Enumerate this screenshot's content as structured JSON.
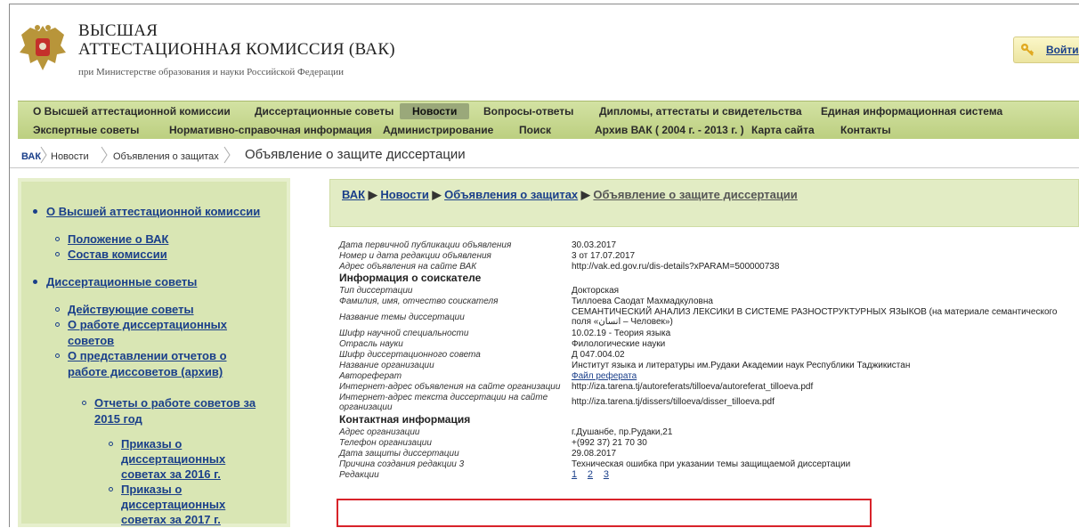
{
  "header": {
    "org_line1": "ВЫСШАЯ",
    "org_line2": "АТТЕСТАЦИОННАЯ КОМИССИЯ (ВАК)",
    "org_sub": "при Министерстве образования и науки Российской Федерации",
    "login_label": "Войти"
  },
  "menu": {
    "row1": [
      "О Высшей аттестационной комиссии",
      "Диссертационные советы",
      "Новости",
      "Вопросы-ответы",
      "Дипломы, аттестаты и свидетельства",
      "Единая информационная система"
    ],
    "row2": [
      "Экспертные советы",
      "Нормативно-справочная информация",
      "Администрирование",
      "Поиск",
      "Архив ВАК ( 2004 г. - 2013 г. )",
      "Карта сайта",
      "Контакты"
    ],
    "active": "Новости"
  },
  "breadcrumb": {
    "items": [
      "ВАК",
      "Новости",
      "Объявления о защитах"
    ],
    "title": "Объявление о защите диссертации"
  },
  "sidebar": {
    "items": [
      "О Высшей аттестационной комиссии",
      "Положение о ВАК",
      "Состав комиссии",
      "Диссертационные советы",
      "Действующие советы",
      "О работе диссертационных",
      "советов",
      "О представлении отчетов о",
      "работе диссоветов (архив)",
      "Отчеты о работе советов за",
      "2015 год",
      "Приказы о",
      "диссертационных",
      "советах за 2016 г.",
      "Приказы о",
      "диссертационных",
      "советах за 2017 г."
    ]
  },
  "content": {
    "path": {
      "root": "ВАК",
      "news": "Новости",
      "announcements": "Объявления о защитах",
      "current": "Объявление о защите диссертации",
      "sep": "▶"
    },
    "rows": [
      {
        "label": "Дата первичной публикации объявления",
        "value": "30.03.2017"
      },
      {
        "label": "Номер и дата редакции объявления",
        "value": "3 от 17.07.2017"
      },
      {
        "label": "Адрес объявления на сайте ВАК",
        "value": "http://vak.ed.gov.ru/dis-details?xPARAM=500000738"
      },
      {
        "label": "Тип диссертации",
        "value": "Докторская"
      },
      {
        "label": "Фамилия, имя, отчество соискателя",
        "value": "Тиллоева Саодат Махмадкуловна"
      },
      {
        "label": "Название темы диссертации",
        "value": "СЕМАНТИЧЕСКИЙ АНАЛИЗ ЛЕКСИКИ В СИСТЕМЕ РАЗНОСТРУКТУРНЫХ ЯЗЫКОВ (на материале семантического поля «انسان – Человек»)"
      },
      {
        "label": "Шифр научной специальности",
        "value": "10.02.19 - Теория языка"
      },
      {
        "label": "Отрасль науки",
        "value": "Филологические науки"
      },
      {
        "label": "Шифр диссертационного совета",
        "value": "Д 047.004.02"
      },
      {
        "label": "Название организации",
        "value": "Институт языка и литературы им.Рудаки Академии наук Республики Таджикистан"
      },
      {
        "label": "Автореферат",
        "value": "Файл реферата"
      },
      {
        "label": "Интернет-адрес объявления на сайте организации",
        "value": "http://iza.tarena.tj/autoreferats/tilloeva/autoreferat_tilloeva.pdf"
      },
      {
        "label": "Интернет-адрес текста диссертации на сайте организации",
        "value": "http://iza.tarena.tj/dissers/tilloeva/disser_tilloeva.pdf"
      },
      {
        "label": "Адрес организации",
        "value": "г.Душанбе, пр.Рудаки,21"
      },
      {
        "label": "Телефон организации",
        "value": "+(992 37) 21 70 30"
      },
      {
        "label": "Дата защиты диссертации",
        "value": "29.08.2017"
      },
      {
        "label": "Причина создания редакции 3",
        "value": "Техническая ошибка при указании темы защищаемой диссертации"
      },
      {
        "label": "Редакции",
        "value": ""
      }
    ],
    "section_applicant": "Информация о соискателе",
    "section_contacts": "Контактная информация",
    "revisions": [
      "1",
      "2",
      "3"
    ]
  }
}
